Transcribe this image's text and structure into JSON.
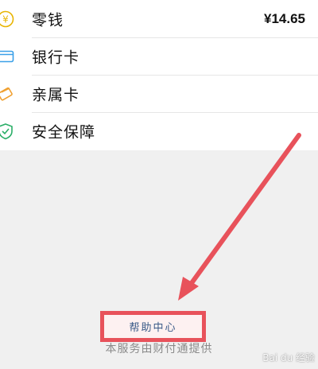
{
  "menu": {
    "items": [
      {
        "label": "零钱",
        "value": "¥14.65",
        "icon": "coin-icon",
        "color": "#e8b400"
      },
      {
        "label": "银行卡",
        "value": "",
        "icon": "bank-card-icon",
        "color": "#3aa0e8"
      },
      {
        "label": "亲属卡",
        "value": "",
        "icon": "family-card-icon",
        "color": "#f0a030"
      },
      {
        "label": "安全保障",
        "value": "",
        "icon": "shield-icon",
        "color": "#2aae67"
      }
    ]
  },
  "footer": {
    "help_label": "帮助中心",
    "service_note": "本服务由财付通提供"
  },
  "colors": {
    "annotation_red": "#e8525b",
    "link_blue": "#3a5a88",
    "background": "#f0f0f0"
  },
  "watermark": "Bai du 经验"
}
